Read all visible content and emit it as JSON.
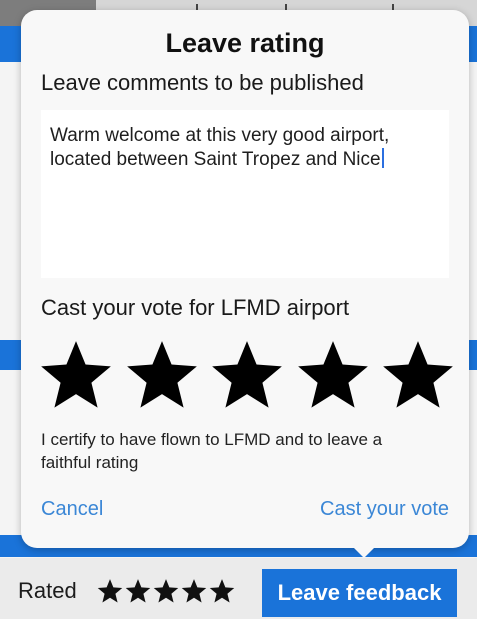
{
  "dialog": {
    "title": "Leave rating",
    "comments_label": "Leave comments to be published",
    "comment_text": "Warm welcome at this very good airport, located between Saint Tropez and Nice",
    "vote_label": "Cast your vote for LFMD airport",
    "stars": {
      "selected": 5,
      "max": 5,
      "icon": "star-icon"
    },
    "certify_text": "I certify to have flown to LFMD and to leave a faithful rating",
    "cancel_label": "Cancel",
    "cast_label": "Cast your vote"
  },
  "bottom_bar": {
    "rated_label": "Rated",
    "rated_stars": 5,
    "feedback_button_label": "Leave feedback"
  },
  "colors": {
    "accent": "#1a73d9",
    "link": "#3b87d6"
  }
}
